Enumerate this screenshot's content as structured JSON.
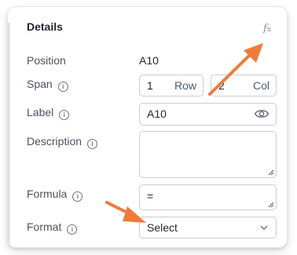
{
  "panel": {
    "title": "Details",
    "fx_icon": {
      "glyph": "f",
      "sub": "x"
    }
  },
  "fields": {
    "position": {
      "label": "Position",
      "value": "A10"
    },
    "span": {
      "label": "Span",
      "row_value": "1",
      "row_unit": "Row",
      "col_value": "2",
      "col_unit": "Col"
    },
    "label": {
      "label": "Label",
      "value": "A10"
    },
    "description": {
      "label": "Description",
      "value": ""
    },
    "formula": {
      "label": "Formula",
      "value": "="
    },
    "format": {
      "label": "Format",
      "selected": "Select"
    }
  },
  "colors": {
    "annotation_arrow": "#f07a3a",
    "text_primary": "#1f2430",
    "text_label": "#4b5160",
    "border": "#c9ccd2"
  }
}
